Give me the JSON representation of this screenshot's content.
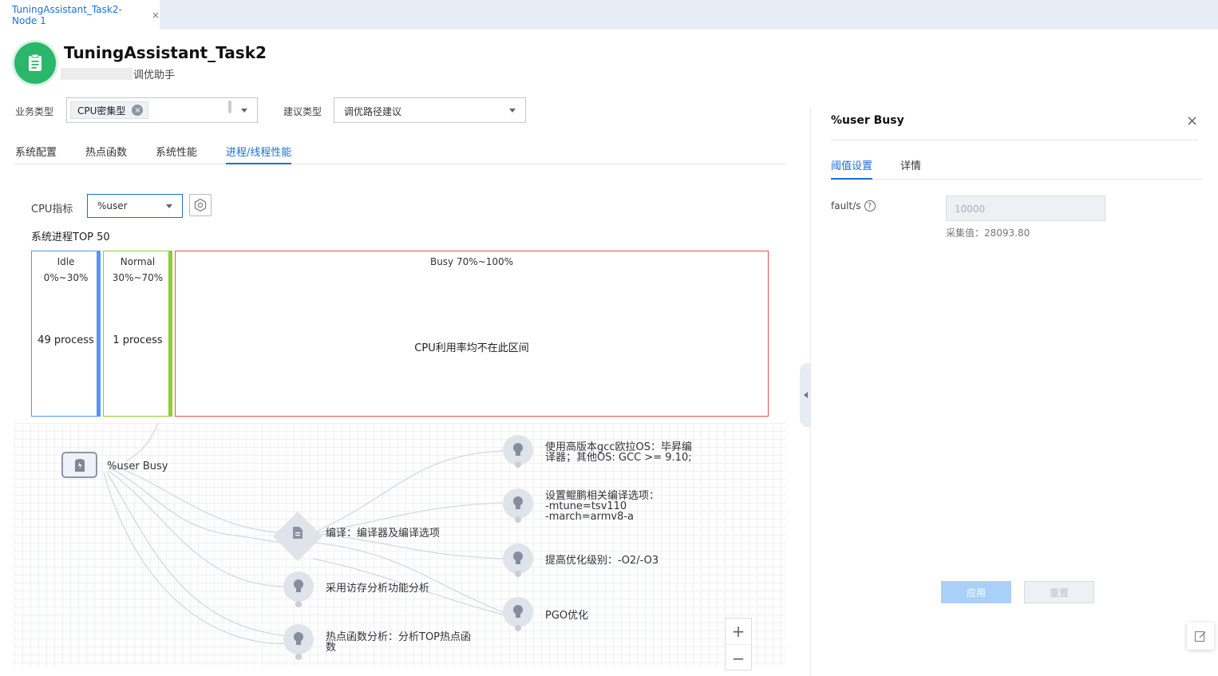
{
  "tab": {
    "label": "TuningAssistant_Task2-Node 1",
    "close": "×"
  },
  "header": {
    "title": "TuningAssistant_Task2",
    "subtitle": "调优助手"
  },
  "filters": {
    "business_label": "业务类型",
    "business_chip": "CPU密集型",
    "chip_remove": "×",
    "advice_label": "建议类型",
    "advice_value": "调优路径建议"
  },
  "tabs": [
    "系统配置",
    "热点函数",
    "系统性能",
    "进程/线程性能"
  ],
  "cpu": {
    "label": "CPU指标",
    "value": "%user"
  },
  "section_title": "系统进程TOP 50",
  "boxes": [
    {
      "name": "Idle",
      "range": "0%~30%",
      "count": "49 process",
      "color": "#5b93f0"
    },
    {
      "name": "Normal",
      "range": "30%~70%",
      "count": "1 process",
      "color": "#8ccf2e"
    },
    {
      "name": "Busy 70%~100%",
      "message": "CPU利用率均不在此区间",
      "color": "#e85050"
    }
  ],
  "graph": {
    "root": "%user Busy",
    "compile": "编译：编译器及编译选项",
    "memory": "采用访存分析功能分析",
    "hotspot": [
      "热点函数分析：分析TOP热点函",
      "数"
    ],
    "gcc": [
      "使用高版本gcc欧拉OS：毕昇编",
      "译器；其他OS: GCC >= 9.10;"
    ],
    "kunpeng": [
      "设置鲲鹏相关编译选项：",
      "-mtune=tsv110",
      "-march=armv8-a"
    ],
    "optlevel": "提高优化级别：-O2/-O3",
    "pgo": "PGO优化"
  },
  "zoom": {
    "in": "+",
    "out": "−"
  },
  "panel": {
    "title": "%user Busy",
    "close": "×",
    "tabs": [
      "阈值设置",
      "详情"
    ],
    "field_label": "fault/s",
    "help": "?",
    "placeholder": "10000",
    "collected": "采集值：28093.80",
    "apply": "应用",
    "reset": "重置"
  }
}
